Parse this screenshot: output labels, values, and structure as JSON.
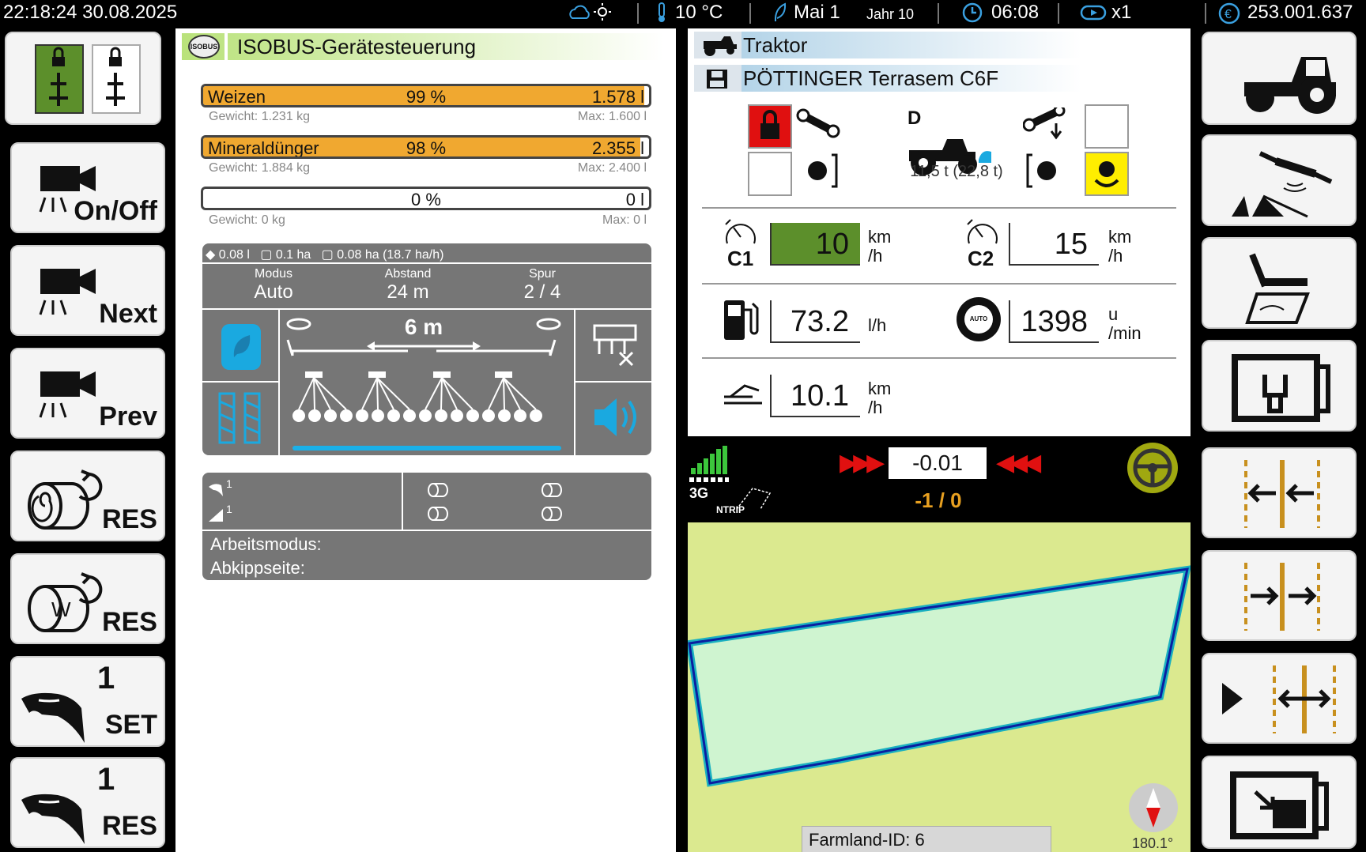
{
  "topbar": {
    "datetime": "22:18:24  30.08.2025",
    "temp": "10 °C",
    "month": "Mai 1",
    "year": "Jahr 10",
    "time": "06:08",
    "speed_mult": "x1",
    "money": "253.001.637"
  },
  "left_buttons": [
    {
      "label": "On/Off",
      "icon": "camera-icon"
    },
    {
      "label": "Next",
      "icon": "camera-icon"
    },
    {
      "label": "Prev",
      "icon": "camera-icon"
    },
    {
      "label": "RES",
      "icon": "bale-icon"
    },
    {
      "label": "RES",
      "icon": "bale-wrap-icon"
    },
    {
      "label": "SET",
      "num": "1",
      "icon": "hand-icon"
    },
    {
      "label": "RES",
      "num": "1",
      "icon": "hand-icon"
    }
  ],
  "isobus": {
    "title": "ISOBUS-Gerätesteuerung",
    "logo": "ISOBUS",
    "fills": [
      {
        "name": "Weizen",
        "percent_text": "99 %",
        "percent": 99,
        "value": "1.578 l",
        "weight": "Gewicht: 1.231 kg",
        "max": "Max: 1.600 l"
      },
      {
        "name": "Mineraldünger",
        "percent_text": "98 %",
        "percent": 98,
        "value": "2.355 l",
        "weight": "Gewicht: 1.884 kg",
        "max": "Max: 2.400 l"
      },
      {
        "name": "",
        "percent_text": "0 %",
        "percent": 0,
        "value": "0 l",
        "weight": "Gewicht: 0 kg",
        "max": "Max: 0 l"
      }
    ],
    "stats": {
      "liters": "0.08 l",
      "area": "0.1 ha",
      "area2": "0.08 ha",
      "rate": "(18.7 ha/h)"
    },
    "mode_label": "Modus",
    "mode_value": "Auto",
    "dist_label": "Abstand",
    "dist_value": "24 m",
    "track_label": "Spur",
    "track_value": "2 / 4",
    "width": "6 m",
    "counter1": "1",
    "counter2": "1",
    "work_mode": "Arbeitsmodus:",
    "tip_side": "Abkippseite:"
  },
  "vehicle": {
    "tractor": "Traktor",
    "implement": "PÖTTINGER Terrasem C6F",
    "drive": "D",
    "weight": "11,5 t (22,8 t)",
    "c1": "C1",
    "c1_value": "10",
    "c1_unit1": "km",
    "c1_unit2": "/h",
    "c2": "C2",
    "c2_value": "15",
    "c2_unit1": "km",
    "c2_unit2": "/h",
    "fuel": "73.2",
    "fuel_unit": "l/h",
    "rpm": "1398",
    "rpm_unit1": "u",
    "rpm_unit2": "/min",
    "rpm_badge": "AUTO",
    "speed": "10.1",
    "speed_unit1": "km",
    "speed_unit2": "/h"
  },
  "gps": {
    "network": "3G",
    "ntrip": "NTRIP",
    "offset": "-0.01",
    "track": "-1 / 0"
  },
  "map": {
    "farmland": "Farmland-ID: 6",
    "heading": "180.1°"
  },
  "colors": {
    "accent_green": "#5c8f2b",
    "fill_orange": "#f0a830",
    "gray_panel": "#767676",
    "alert_red": "#e01010",
    "blue_icon": "#1aa9e0"
  }
}
